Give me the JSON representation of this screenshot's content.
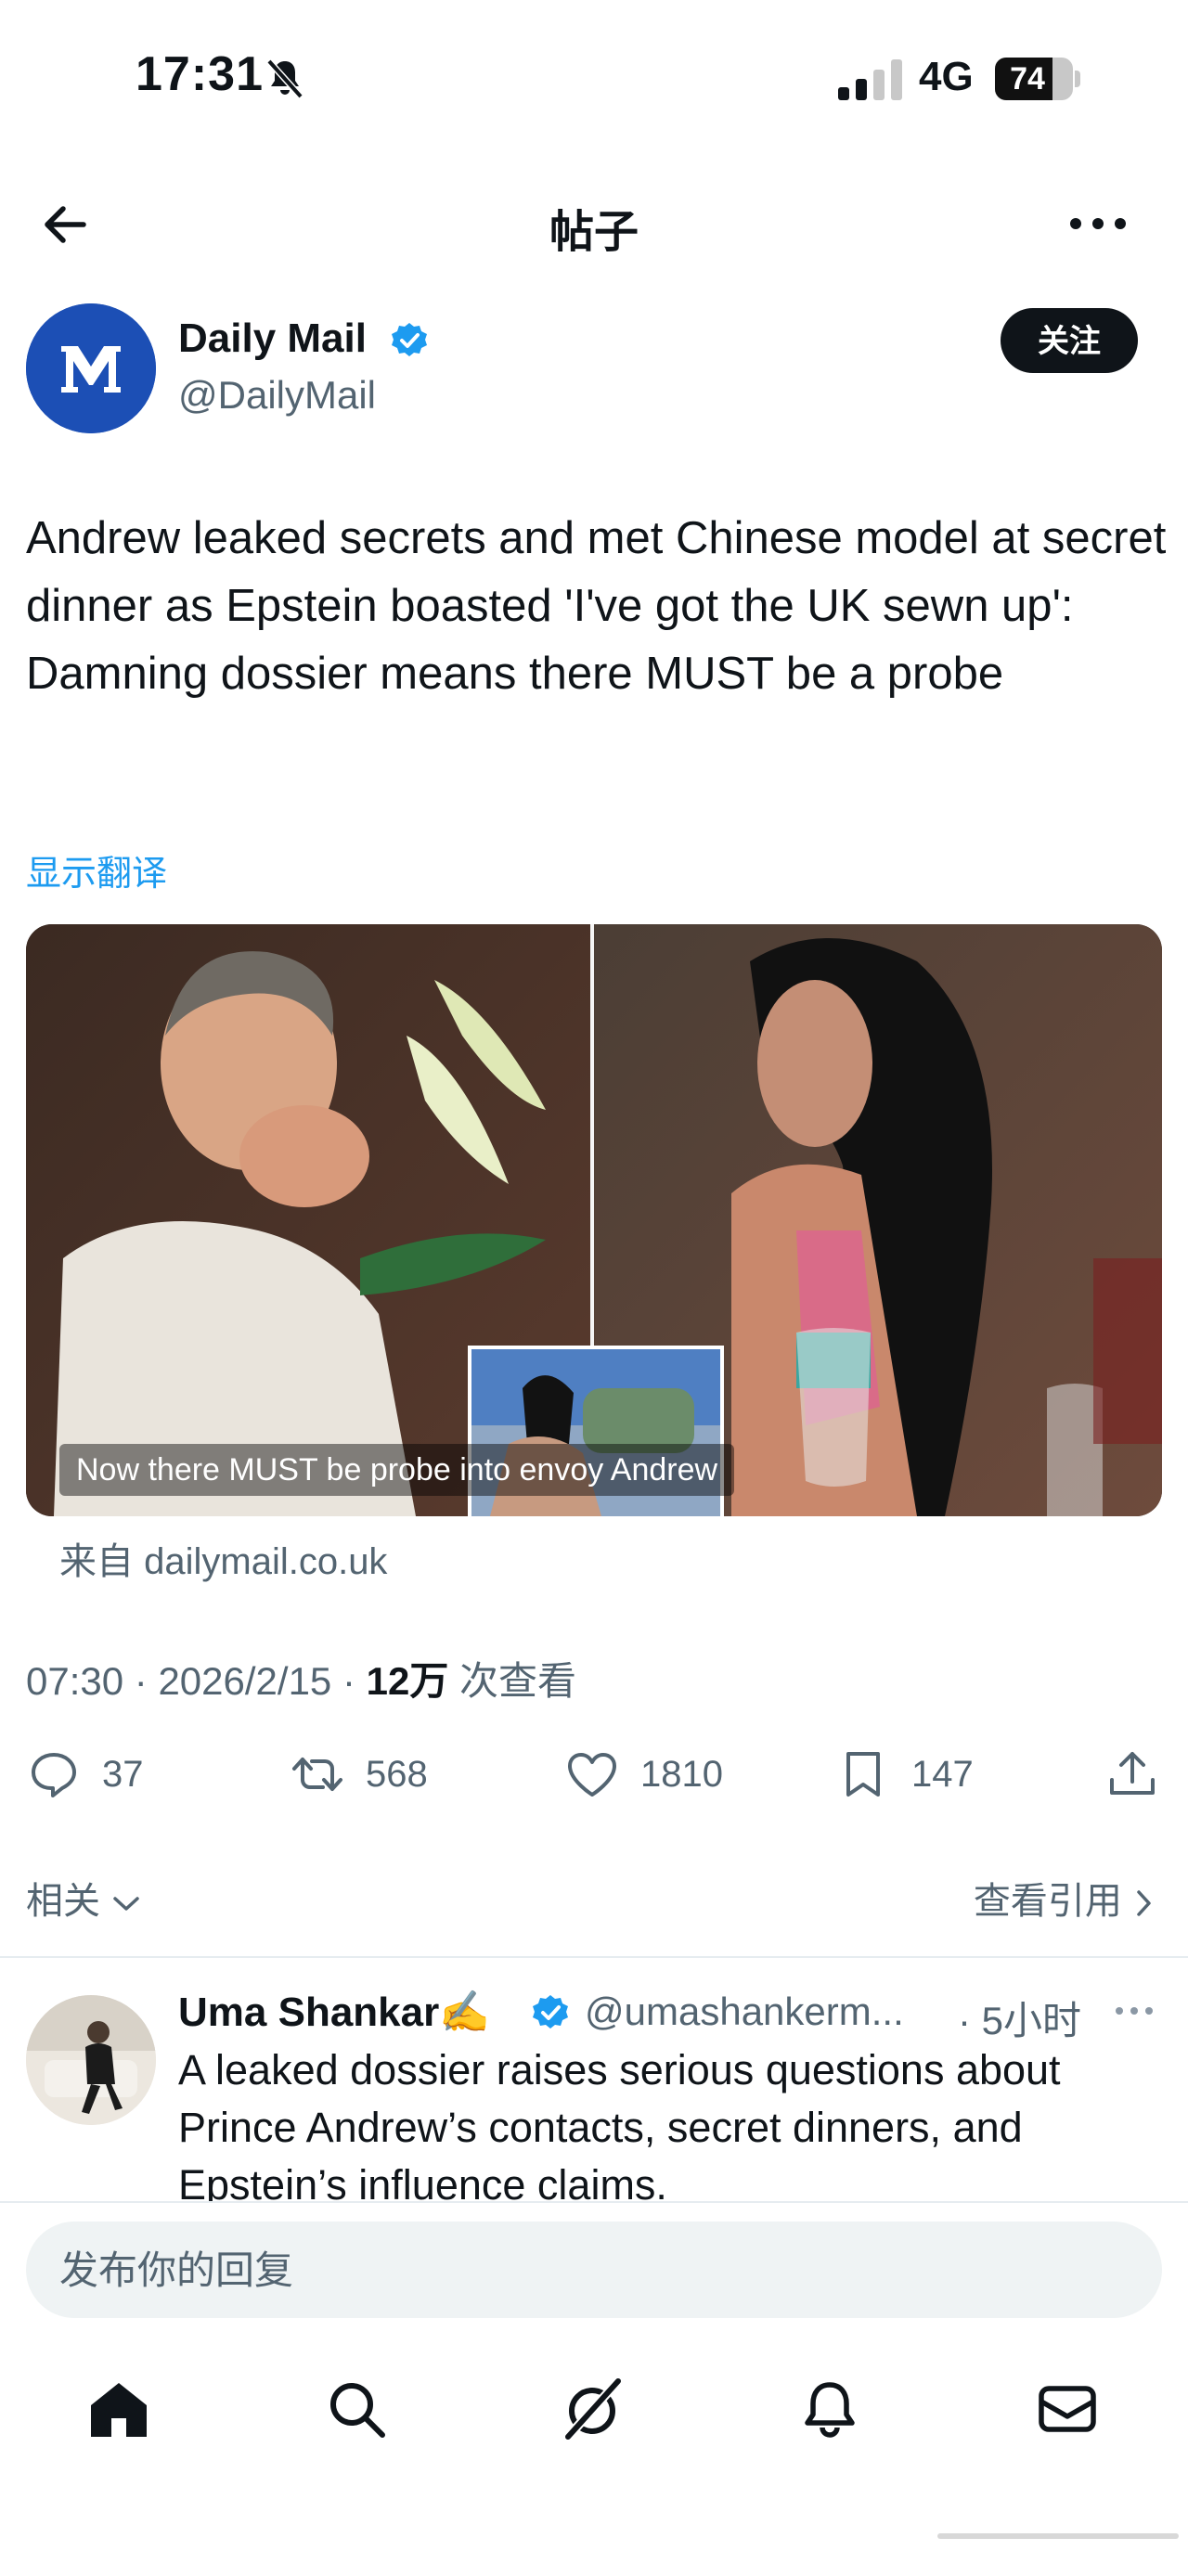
{
  "status_bar": {
    "time": "17:31",
    "network": "4G",
    "battery": "74",
    "battery_level": 0.74
  },
  "header": {
    "title": "帖子"
  },
  "author": {
    "name": "Daily Mail",
    "handle": "@DailyMail",
    "follow_label": "关注"
  },
  "tweet": {
    "text": "Andrew leaked secrets and met Chinese model at secret dinner as Epstein boasted 'I've got the UK sewn up': Damning dossier means there MUST be a probe",
    "translate_label": "显示翻译",
    "media_caption": "Now there MUST be probe into envoy Andrew",
    "source": "来自 dailymail.co.uk",
    "time": "07:30",
    "date": "2026/2/15",
    "views": "12万",
    "views_suffix": "次查看"
  },
  "actions": {
    "replies": "37",
    "retweets": "568",
    "likes": "1810",
    "bookmarks": "147"
  },
  "related_label": "相关",
  "view_quotes_label": "查看引用",
  "reply": {
    "name": "Uma Shankar✍️",
    "handle": "@umashankerm...",
    "separator": "·",
    "time": "5小时",
    "text": "A leaked dossier raises serious questions about Prince Andrew’s contacts, secret dinners, and Epstein’s influence claims."
  },
  "compose": {
    "placeholder": "发布你的回复"
  },
  "icons": {
    "back": "arrow-left-icon",
    "more": "more-horizontal-icon",
    "verified": "verified-badge-icon",
    "reply": "reply-icon",
    "retweet": "retweet-icon",
    "like": "heart-icon",
    "bookmark": "bookmark-icon",
    "share": "share-icon",
    "home": "home-icon",
    "search": "search-icon",
    "grok": "grok-icon",
    "notifications": "bell-icon",
    "messages": "mail-icon",
    "mute": "bell-slash-icon"
  },
  "colors": {
    "accent": "#1d9bf0",
    "text": "#0f1419",
    "secondary": "#536471",
    "avatar_blue": "#1c4fb5"
  }
}
